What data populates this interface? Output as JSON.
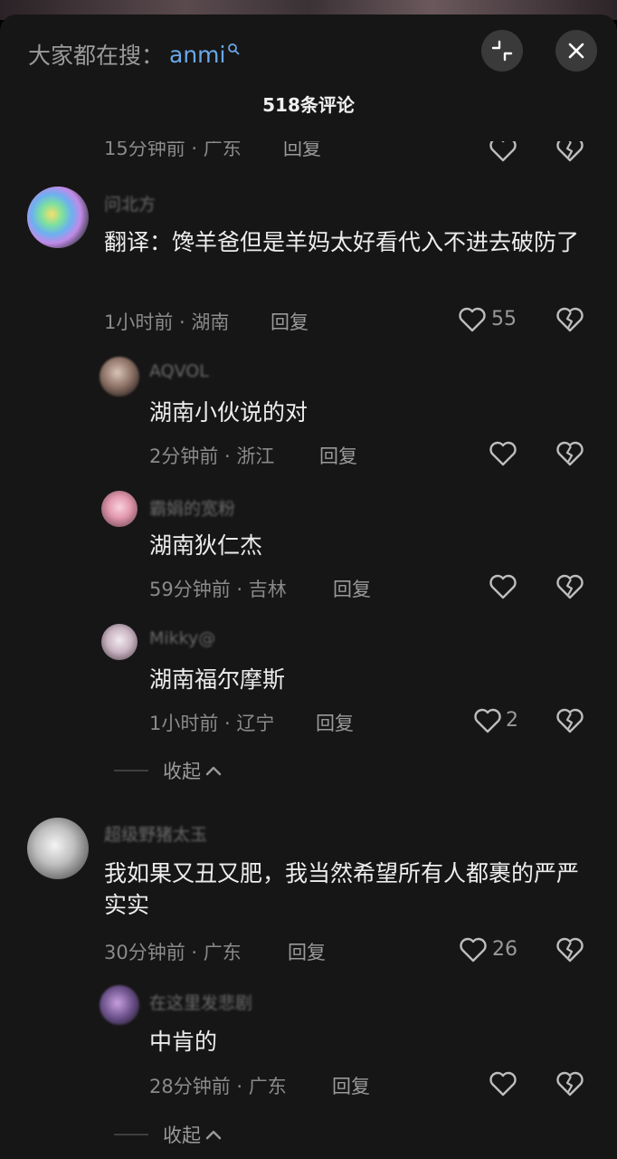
{
  "search": {
    "prefix": "大家都在搜：",
    "term": "anmi"
  },
  "header": {
    "count_title": "518条评论"
  },
  "partial_top": {
    "meta": "15分钟前 · 广东",
    "reply": "回复"
  },
  "comments": [
    {
      "name": "问北方",
      "text": "翻译：馋羊爸但是羊妈太好看代入不进去破防了",
      "meta": "1小时前 · 湖南",
      "reply": "回复",
      "likes": "55",
      "replies": [
        {
          "name": "AQVOL",
          "text": "湖南小伙说的对",
          "meta": "2分钟前 · 浙江",
          "reply": "回复",
          "likes": ""
        },
        {
          "name": "霸娟的宽粉",
          "text": "湖南狄仁杰",
          "meta": "59分钟前 · 吉林",
          "reply": "回复",
          "likes": ""
        },
        {
          "name": "Mikky@",
          "text": "湖南福尔摩斯",
          "meta": "1小时前 · 辽宁",
          "reply": "回复",
          "likes": "2"
        }
      ],
      "collapse": "收起"
    },
    {
      "name": "超级野猪太玉",
      "text": "我如果又丑又肥，我当然希望所有人都裹的严严实实",
      "meta": "30分钟前 · 广东",
      "reply": "回复",
      "likes": "26",
      "replies": [
        {
          "name": "在这里发悲剧",
          "text": "中肯的",
          "meta": "28分钟前 · 广东",
          "reply": "回复",
          "likes": ""
        }
      ],
      "collapse": "收起"
    }
  ],
  "colors": {
    "sheet_bg": "#161616",
    "accent_link": "#6aa8e8",
    "meta_gray": "#8a8a8a"
  },
  "icons": [
    "search-icon",
    "collapse-icon",
    "close-icon",
    "heart-icon",
    "broken-heart-icon",
    "chevron-up-icon"
  ]
}
